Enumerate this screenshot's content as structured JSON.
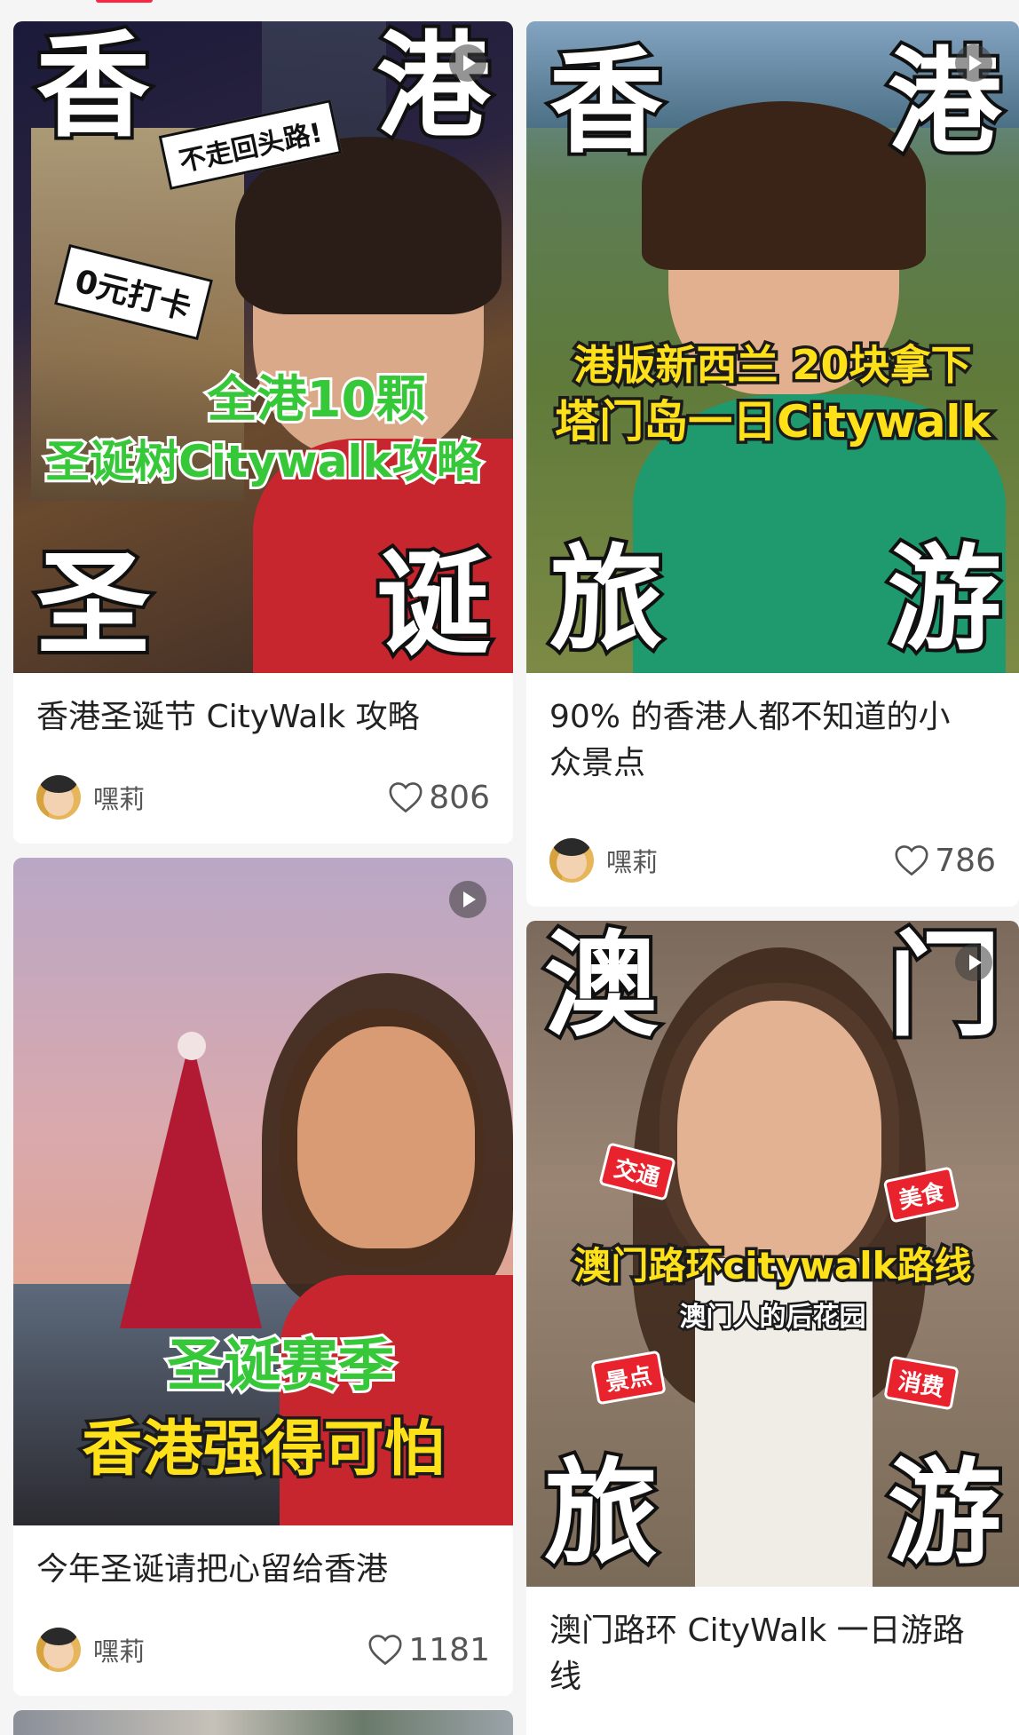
{
  "feed": {
    "cards": [
      {
        "title": "香港圣诞节 CityWalk 攻略",
        "author": "嘿莉",
        "likes": "806",
        "cover": {
          "top_left": "香",
          "top_right": "港",
          "bottom_left": "圣",
          "bottom_right": "诞",
          "sticker_1": "不走回头路!",
          "sticker_2": "0元打卡",
          "caption_line_1": "全港10颗",
          "caption_line_2": "圣诞树Citywalk攻略"
        }
      },
      {
        "title": "90% 的香港人都不知道的小众景点",
        "author": "嘿莉",
        "likes": "786",
        "cover": {
          "top_left": "香",
          "top_right": "港",
          "bottom_left": "旅",
          "bottom_right": "游",
          "caption_line_1": "港版新西兰 20块拿下",
          "caption_line_2": "塔门岛一日Citywalk"
        }
      },
      {
        "title": "今年圣诞请把心留给香港",
        "author": "嘿莉",
        "likes": "1181",
        "cover": {
          "caption_line_1": "圣诞赛季",
          "caption_line_2": "香港强得可怕"
        }
      },
      {
        "title": "澳门路环 CityWalk 一日游路线",
        "cover": {
          "top_left": "澳",
          "top_right": "门",
          "bottom_left": "旅",
          "bottom_right": "游",
          "tag_1": "交通",
          "tag_2": "美食",
          "tag_3": "景点",
          "tag_4": "消费",
          "caption_line_1": "澳门路环citywalk路线",
          "caption_line_2": "澳门人的后花园"
        }
      }
    ]
  },
  "colors": {
    "accent": "#ff2442",
    "caption_green": "#37c83a",
    "caption_yellow": "#ffe11a"
  },
  "icons": [
    "play-icon",
    "heart-outline-icon",
    "avatar"
  ]
}
